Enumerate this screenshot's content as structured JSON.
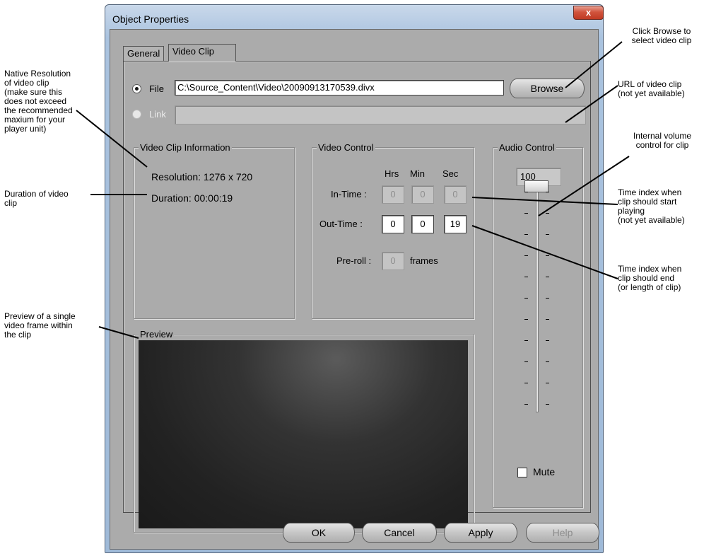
{
  "window": {
    "title": "Object Properties",
    "close_glyph": "x"
  },
  "tabs": [
    {
      "label": "General"
    },
    {
      "label": "Video Clip"
    }
  ],
  "file": {
    "label": "File",
    "value": "C:\\Source_Content\\Video\\20090913170539.divx",
    "browse_label": "Browse"
  },
  "link": {
    "label": "Link",
    "value": ""
  },
  "clip_info": {
    "legend": "Video Clip Information",
    "resolution": "Resolution: 1276 x 720",
    "duration": "Duration: 00:00:19"
  },
  "video_control": {
    "legend": "Video Control",
    "headers": {
      "hrs": "Hrs",
      "min": "Min",
      "sec": "Sec"
    },
    "in_label": "In-Time :",
    "in": {
      "hrs": "0",
      "min": "0",
      "sec": "0"
    },
    "out_label": "Out-Time :",
    "out": {
      "hrs": "0",
      "min": "0",
      "sec": "19"
    },
    "preroll_label": "Pre-roll :",
    "preroll": "0",
    "frames_label": "frames"
  },
  "audio_control": {
    "legend": "Audio Control",
    "volume": "100",
    "mute_label": "Mute"
  },
  "preview": {
    "legend": "Preview"
  },
  "buttons": {
    "ok": "OK",
    "cancel": "Cancel",
    "apply": "Apply",
    "help": "Help"
  },
  "annotations": {
    "browse": "Click Browse to\nselect video clip",
    "url": "URL of video clip\n(not yet available)",
    "volume": "Internal volume\ncontrol for clip",
    "start": "Time index when\nclip should start\nplaying\n(not yet available)",
    "end": "Time index when\nclip should end\n(or length of clip)",
    "resolution": "Native Resolution\nof video clip\n(make sure this\ndoes not exceed\nthe recommended\nmaxium for your\nplayer unit)",
    "duration": "Duration of video\nclip",
    "preview": "Preview of a single\nvideo frame within\nthe clip"
  }
}
